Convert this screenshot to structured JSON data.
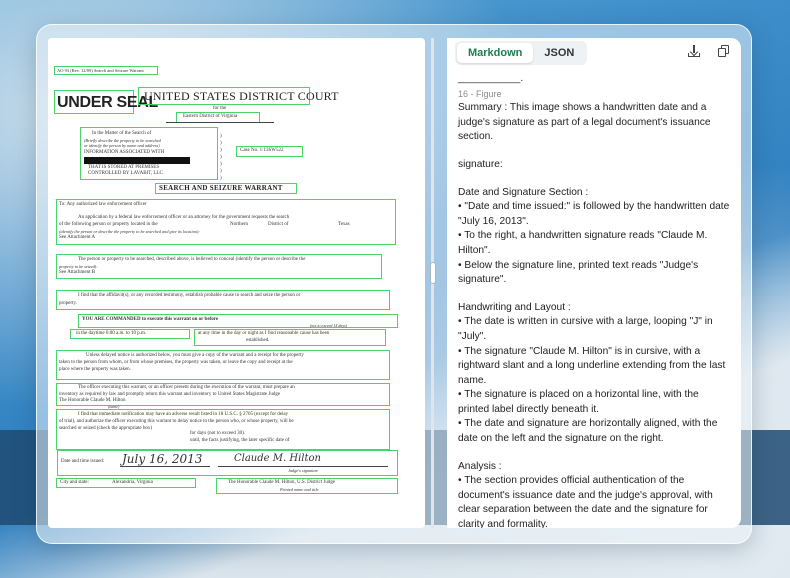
{
  "toolbar": {
    "tab_markdown": "Markdown",
    "tab_json": "JSON",
    "download_icon": "download-icon",
    "copy_icon": "copy-icon"
  },
  "panel": {
    "leading_underscore": "___________.",
    "figure_label": "16 - Figure",
    "summary": "Summary : This image shows a handwritten date and a judge's signature as part of a legal document's issuance section.",
    "signature_label": "signature:",
    "section1_title": "Date and Signature Section :",
    "section1_items": [
      "• \"Date and time issued:\" is followed by the handwritten date \"July 16, 2013\".",
      "• To the right, a handwritten signature reads \"Claude M. Hilton\".",
      "• Below the signature line, printed text reads \"Judge's signature\"."
    ],
    "section2_title": "Handwriting and Layout :",
    "section2_items": [
      "• The date is written in cursive with a large, looping \"J\" in \"July\".",
      "• The signature \"Claude M. Hilton\" is in cursive, with a rightward slant and a long underline extending from the last name.",
      "• The signature is placed on a horizontal line, with the printed label directly beneath it.",
      "• The date and signature are horizontally aligned, with the date on the left and the signature on the right."
    ],
    "section3_title": "Analysis :",
    "section3_items": [
      "• The section provides official authentication of the document's issuance date and the judge's approval, with clear separation between the date and the signature for clarity and formality."
    ]
  },
  "document": {
    "form_id": "AO 93  (Rev. 12/09) Search and Seizure Warrant",
    "under_seal": "UNDER SEAL",
    "court": "UNITED STATES DISTRICT COURT",
    "for_the": "for the",
    "district": "Eastern District of Virginia",
    "matter_1": "In the Matter of the Search of",
    "matter_2": "(Briefly describe the property to be searched",
    "matter_3": "or identify the person by name and address)",
    "matter_4": "INFORMATION ASSOCIATED WITH",
    "matter_5": "THAT IS STORED AT PREMISES",
    "matter_6": "CONTROLLED BY LAVABIT, LLC",
    "case_no": "Case No. 1:13SW522",
    "title": "SEARCH AND SEIZURE WARRANT",
    "to": "To:      Any authorized law enforcement officer",
    "app_1": "An application by a federal law enforcement officer or an attorney for the government requests the search",
    "app_2": "of the following person or property located in the",
    "app_district": "Northern",
    "app_district_label": "District of",
    "app_state": "Texas",
    "app_3": "(identify the person or describe the property to be searched and give its location):",
    "attach_a": "See Attachment A",
    "conceal_1": "The person or property to be searched, described above, is believed to conceal (identify the person or describe the",
    "conceal_2": "property to be seized):",
    "attach_b": "See Attachment B",
    "find_1": "I find that the affidavit(s), or any recorded testimony, establish probable cause to search and seize the person or",
    "find_2": "property.",
    "commanded": "YOU ARE COMMANDED to execute this warrant on or before",
    "not_exceed": "(not to exceed 14 days)",
    "daytime": "in the daytime  6:00 a.m. to 10 p.m.",
    "anytime_1": "at any time in the day or night as I find reasonable cause has been",
    "anytime_2": "established.",
    "notice_1": "Unless delayed notice is authorized below, you must give a copy of the warrant and a receipt for the property",
    "notice_2": "taken to the person from whom, or from whose premises, the property was taken, or leave the copy and receipt at the",
    "notice_3": "place where the property was taken.",
    "officer_1": "The officer executing this warrant, or an officer present during the execution of the warrant, must prepare an",
    "officer_2": "inventory as required by law and promptly return this warrant and inventory to United States Magistrate Judge",
    "officer_3": "The Honorable Claude M. Hilton",
    "officer_name": "(name)",
    "delay_1": "I find that immediate notification may have an adverse result listed in 18 U.S.C. § 2705 (except for delay",
    "delay_2": "of trial), and authorize the officer executing this warrant to delay notice to the person who, or whose property, will be",
    "delay_3": "searched or seized (check the appropriate box)",
    "delay_4": "for           days (not to exceed 30).",
    "delay_5": "until, the facts justifying, the later specific date of",
    "issued_label": "Date and time issued:",
    "issued_date": "July 16, 2013",
    "signature": "Claude M. Hilton",
    "judge_sig_label": "Judge's signature",
    "city_label": "City and state:",
    "city_value": "Alexandria, Virginia",
    "printed_name": "The Honorable Claude M. Hilton, U.S. District Judge",
    "printed_label": "Printed name and title"
  }
}
